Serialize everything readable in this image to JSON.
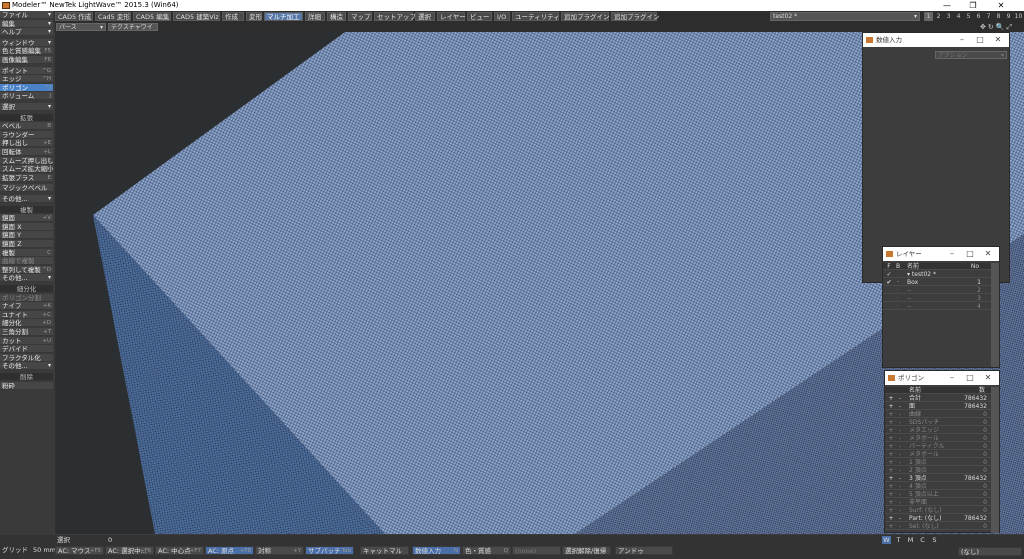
{
  "window": {
    "title": "Modeler™ NewTek LightWave™ 2015.3 (Win64)",
    "minimize": "—",
    "maximize": "❐",
    "close": "✕"
  },
  "menubar": {
    "items": [
      "CAD5 作成",
      "Cad5 変形",
      "CAD5 編集",
      "CAD5 建築Viz",
      "作成",
      "変形",
      "マルチ加工",
      "詳細",
      "構造",
      "マップ",
      "セットアップ",
      "選択",
      "レイヤー",
      "ビュー",
      "I/O",
      "ユーティリティ",
      "追加プラグイン",
      "追加プラグイン"
    ],
    "active_index": 6,
    "layer_select": "test02 *",
    "page_nums": [
      "1",
      "2",
      "3",
      "4",
      "5",
      "6",
      "7",
      "8",
      "9",
      "10"
    ]
  },
  "toolbar": {
    "view_mode": "パース",
    "shading_mode": "テクスチャワイヤー"
  },
  "sidebar": {
    "items": [
      {
        "label": "ファイル",
        "arrow": "▾",
        "type": "btn"
      },
      {
        "label": "編集",
        "arrow": "▾",
        "type": "btn"
      },
      {
        "label": "ヘルプ",
        "arrow": "▾",
        "type": "btn"
      },
      {
        "label": "",
        "type": "gap"
      },
      {
        "label": "ウィンドウ",
        "arrow": "▾",
        "type": "btn"
      },
      {
        "label": "色と質感編集",
        "sc": "F5",
        "type": "btn"
      },
      {
        "label": "画像編集",
        "sc": "F6",
        "type": "btn"
      },
      {
        "label": "",
        "type": "gap"
      },
      {
        "label": "ポイント",
        "sc": "^G",
        "type": "btn"
      },
      {
        "label": "エッジ",
        "sc": "^H",
        "type": "btn"
      },
      {
        "label": "ポリゴン",
        "sc": "^J",
        "type": "sel"
      },
      {
        "label": "ボリューム",
        "sc": "J",
        "type": "btn"
      },
      {
        "label": "",
        "type": "gap"
      },
      {
        "label": "選択",
        "arrow": "▾",
        "type": "btn"
      },
      {
        "label": "",
        "type": "gap"
      },
      {
        "label": "拡張",
        "type": "hdr"
      },
      {
        "label": "ベベル",
        "sc": "B",
        "type": "btn"
      },
      {
        "label": "ラウンダー",
        "type": "btn"
      },
      {
        "label": "押し出し",
        "sc": "+E",
        "type": "btn"
      },
      {
        "label": "回転体",
        "sc": "+L",
        "type": "btn"
      },
      {
        "label": "スムーズ押し出し",
        "sc": "+E",
        "type": "btn"
      },
      {
        "label": "スムーズ拡大縮小",
        "sc": "+H",
        "type": "btn"
      },
      {
        "label": "拡張プラス",
        "sc": "E",
        "type": "btn"
      },
      {
        "label": "",
        "type": "gap"
      },
      {
        "label": "マジックベベル",
        "type": "btn"
      },
      {
        "label": "",
        "type": "gap"
      },
      {
        "label": "その他...",
        "arrow": "▾",
        "type": "btn"
      },
      {
        "label": "",
        "type": "gap"
      },
      {
        "label": "複製",
        "type": "hdr"
      },
      {
        "label": "鏡面",
        "sc": "+V",
        "type": "btn"
      },
      {
        "label": "鏡面 X",
        "type": "btn"
      },
      {
        "label": "鏡面 Y",
        "type": "btn"
      },
      {
        "label": "鏡面 Z",
        "type": "btn"
      },
      {
        "label": "複製",
        "sc": "C",
        "type": "btn"
      },
      {
        "label": "曲線で複製",
        "sc": "",
        "type": "dim"
      },
      {
        "label": "整列して複製",
        "sc": "^D",
        "type": "btn"
      },
      {
        "label": "その他...",
        "arrow": "▾",
        "type": "btn"
      },
      {
        "label": "",
        "type": "gap"
      },
      {
        "label": "細分化",
        "type": "hdr"
      },
      {
        "label": "ポリゴン分割",
        "type": "dim"
      },
      {
        "label": "ナイフ",
        "sc": "+K",
        "type": "btn"
      },
      {
        "label": "ユナイト",
        "sc": "+C",
        "type": "btn"
      },
      {
        "label": "細分化",
        "sc": "+D",
        "type": "btn"
      },
      {
        "label": "三角分割",
        "sc": "+T",
        "type": "btn"
      },
      {
        "label": "カット",
        "sc": "+U",
        "type": "btn"
      },
      {
        "label": "デバイド",
        "type": "btn"
      },
      {
        "label": "フラクタル化",
        "type": "btn"
      },
      {
        "label": "その他...",
        "arrow": "▾",
        "type": "btn"
      },
      {
        "label": "",
        "type": "gap"
      },
      {
        "label": "削除",
        "type": "hdr"
      },
      {
        "label": "粉砕",
        "type": "btn"
      }
    ]
  },
  "panels": {
    "numeric": {
      "title": "数値入力",
      "dropdown": "アクション"
    },
    "layers": {
      "title": "レイヤー",
      "headers": {
        "f": "F",
        "b": "B",
        "name": "名前",
        "no": "No"
      },
      "rows": [
        {
          "f": "✓",
          "b": "",
          "name": "▾ test02 *",
          "no": "",
          "dim": false
        },
        {
          "f": "✔",
          "b": "·",
          "name": "Box",
          "no": "1",
          "dim": false
        },
        {
          "f": "",
          "b": "·",
          "name": "--",
          "no": "2",
          "dim": true
        },
        {
          "f": "",
          "b": "·",
          "name": "--",
          "no": "3",
          "dim": true
        },
        {
          "f": "",
          "b": "·",
          "name": "--",
          "no": "4",
          "dim": true
        }
      ]
    },
    "stats": {
      "title": "ポリゴン",
      "headers": {
        "name": "名前",
        "count": "数"
      },
      "rows": [
        {
          "name": "合計",
          "value": "786432",
          "dim": false
        },
        {
          "name": "面",
          "value": "786432",
          "dim": false
        },
        {
          "name": "曲線",
          "value": "0",
          "dim": true
        },
        {
          "name": "SDSパッチ",
          "value": "0",
          "dim": true
        },
        {
          "name": "メタエッジ",
          "value": "0",
          "dim": true
        },
        {
          "name": "メタボール",
          "value": "0",
          "dim": true
        },
        {
          "name": "パーティクル",
          "value": "0",
          "dim": true
        },
        {
          "name": "メタボール",
          "value": "0",
          "dim": true
        },
        {
          "name": "1 頂点",
          "value": "0",
          "dim": true
        },
        {
          "name": "2 頂点",
          "value": "0",
          "dim": true
        },
        {
          "name": "3 頂点",
          "value": "786432",
          "dim": false
        },
        {
          "name": "4 頂点",
          "value": "0",
          "dim": true
        },
        {
          "name": "5 頂点以上",
          "value": "0",
          "dim": true
        },
        {
          "name": "非平面",
          "value": "0",
          "dim": true
        },
        {
          "name": "Surf: (なし)",
          "value": "0",
          "dim": true
        },
        {
          "name": "Part: (なし)",
          "value": "786432",
          "dim": false
        },
        {
          "name": "Sel: (なし)",
          "value": "0",
          "dim": true
        }
      ]
    }
  },
  "statusbar": {
    "selection_label": "選択",
    "selection_value": "0",
    "grid_label": "グリッド",
    "grid_value": "50 mm",
    "buttons": [
      {
        "label": "AC: マウス",
        "sc": "+F5"
      },
      {
        "label": "AC: 選択中...",
        "sc": "+F6"
      },
      {
        "label": "AC: 中心点",
        "sc": "+F7"
      },
      {
        "label": "AC: 原点",
        "sc": "+F8",
        "blue": true
      },
      {
        "label": "対称",
        "sc": "+Y"
      },
      {
        "label": "サブパッチ",
        "sc": "Tab",
        "blue": true
      },
      {
        "label": "キャットマル",
        "sc": "",
        "blue": false
      },
      {
        "label": "数値入力",
        "sc": "N",
        "blue": true
      },
      {
        "label": "色・質感",
        "sc": "Q"
      },
      {
        "label": "(none)",
        "sc": "",
        "dim": true
      },
      {
        "label": "選択解除/復帰",
        "sc": ""
      },
      {
        "label": "アンドゥ",
        "sc": ""
      }
    ],
    "view_tabs": [
      "W",
      "T",
      "M",
      "C",
      "S"
    ],
    "vmap": "(なし)"
  }
}
